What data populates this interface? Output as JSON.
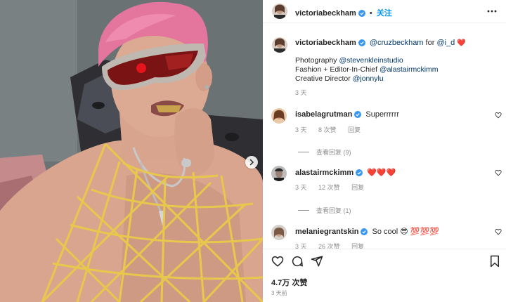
{
  "colors": {
    "accent": "#0095f6",
    "link": "#00376b",
    "muted": "#8e8e8e",
    "heart": "#ed4956"
  },
  "post": {
    "author": "victoriabeckham",
    "follow_label": "关注",
    "more_icon": "more-horizontal-icon",
    "next_icon": "chevron-right-icon"
  },
  "caption": {
    "author": "victoriabeckham",
    "mention1": "@cruzbeckham",
    "for_word": " for ",
    "mention2": "@i_d",
    "emoji": "❤️",
    "line2_prefix": "Photography ",
    "line2_link": "@stevenkleinstudio",
    "line3_prefix": "Fashion + Editor-In-Chief ",
    "line3_link": "@alastairmckimm",
    "line4_prefix": "Creative Director ",
    "line4_link": "@jonnylu",
    "time": "3 天"
  },
  "comments": [
    {
      "user": "isabelagrutman",
      "text": "Superrrrrr",
      "time": "3 天",
      "likes": "8 次赞",
      "reply": "回复",
      "view_replies": "查看回复 (9)"
    },
    {
      "user": "alastairmckimm",
      "text": "❤️❤️❤️",
      "time": "3 天",
      "likes": "12 次赞",
      "reply": "回复",
      "view_replies": "查看回复 (1)"
    },
    {
      "user": "melaniegrantskin",
      "text": "So cool 😎 💯💯💯",
      "time": "3 天",
      "likes": "26 次赞",
      "reply": "回复"
    }
  ],
  "actions": {
    "like_icon": "heart-icon",
    "comment_icon": "comment-icon",
    "share_icon": "share-icon",
    "save_icon": "bookmark-icon",
    "likes": "4.7万 次赞",
    "post_time": "3 天前"
  }
}
